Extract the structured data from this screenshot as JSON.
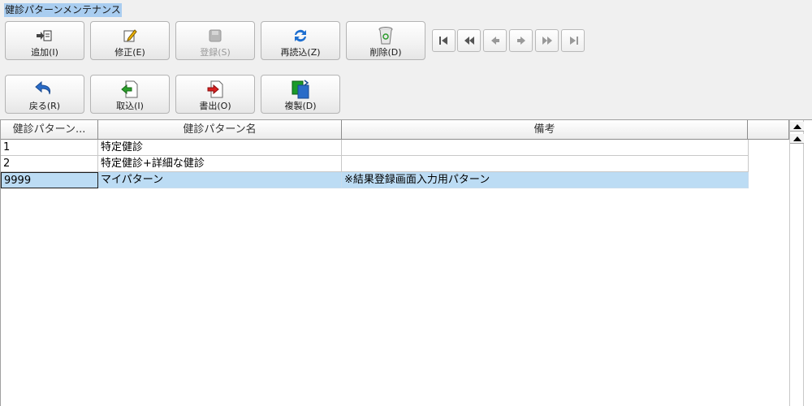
{
  "window": {
    "title": "健診パターンメンテナンス"
  },
  "toolbar1": [
    {
      "label": "追加(I)",
      "icon": "add-doc-icon",
      "enabled": true
    },
    {
      "label": "修正(E)",
      "icon": "edit-pencil-icon",
      "enabled": true
    },
    {
      "label": "登録(S)",
      "icon": "save-icon",
      "enabled": false
    },
    {
      "label": "再読込(Z)",
      "icon": "refresh-icon",
      "enabled": true
    },
    {
      "label": "削除(D)",
      "icon": "trash-icon",
      "enabled": true
    }
  ],
  "toolbar2": [
    {
      "label": "戻る(R)",
      "icon": "undo-arrow-icon"
    },
    {
      "label": "取込(I)",
      "icon": "import-doc-icon"
    },
    {
      "label": "書出(O)",
      "icon": "export-doc-icon"
    },
    {
      "label": "複製(D)",
      "icon": "duplicate-icon"
    }
  ],
  "nav_buttons": [
    "first-record-icon",
    "prev-page-icon",
    "prev-record-icon",
    "next-record-icon",
    "next-page-icon",
    "last-record-icon"
  ],
  "table": {
    "columns": [
      "健診パターン...",
      "健診パターン名",
      "備考"
    ],
    "rows": [
      {
        "id": "1",
        "name": "特定健診",
        "note": ""
      },
      {
        "id": "2",
        "name": "特定健診+詳細な健診",
        "note": ""
      },
      {
        "id": "9999",
        "name": "マイパターン",
        "note": "※結果登録画面入力用パターン"
      }
    ]
  },
  "colors": {
    "selection": "#bcdcf4",
    "title_highlight": "#a9cdf0"
  }
}
